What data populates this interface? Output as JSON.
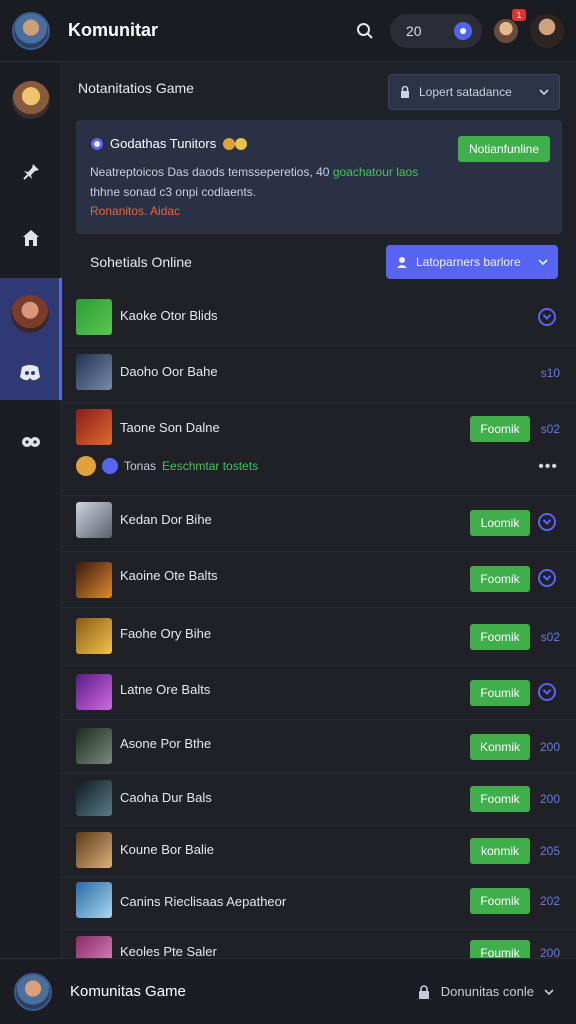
{
  "app": {
    "title": "Komunitar"
  },
  "topbar": {
    "count": "20",
    "notification_badge": "1"
  },
  "section": {
    "heading": "Notanitatios Game",
    "select_label": "Lopert satadance"
  },
  "card": {
    "title": "Godathas Tunitors",
    "body_prefix": "Neatreptoicos Das daods temsseperetios, 40",
    "body_highlight": "goachatour laos",
    "body_suffix": "thhne sonad c3 onpi codlaents.",
    "link": "Ronanitos. Aidac",
    "button_label": "Notianfunline"
  },
  "sub": {
    "heading": "Sohetials Online",
    "select_label": "Latoparners barlore"
  },
  "rows": [
    {
      "name": "Kaoke Otor Blids",
      "meta": "",
      "button": ""
    },
    {
      "name": "Daoho Oor Bahe",
      "meta": "s10",
      "button": ""
    },
    {
      "name": "Taone Son Dalne",
      "meta": "s02",
      "button": "Foomik",
      "sub_muted": "Tonas",
      "sub_green": "Eeschmtar tostets"
    },
    {
      "name": "Kedan Dor Bihe",
      "meta": "",
      "button": "Loomik"
    },
    {
      "name": "Kaoine Ote Balts",
      "meta": "",
      "button": "Foomik"
    },
    {
      "name": "Faohe Ory Bihe",
      "meta": "s02",
      "button": "Foomik"
    },
    {
      "name": "Latne Ore Balts",
      "meta": "",
      "button": "Foumik"
    },
    {
      "name": "Asone Por Bthe",
      "meta": "200",
      "button": "Konmik"
    },
    {
      "name": "Caoha Dur Bals",
      "meta": "200",
      "button": "Foomik"
    },
    {
      "name": "Koune Bor Balie",
      "meta": "205",
      "button": "konmik"
    },
    {
      "name": "Canins Rieclisaas Aepatheor",
      "meta": "202",
      "button": "Foomik"
    },
    {
      "name": "Keoles Pte Saler",
      "meta": "200",
      "button": "Foumik"
    }
  ],
  "footer": {
    "title": "Komunitas Game",
    "right_label": "Donunitas conle"
  },
  "colors": {
    "accent": "#5865f2",
    "green": "#3fae4b",
    "background": "#1f2127"
  }
}
